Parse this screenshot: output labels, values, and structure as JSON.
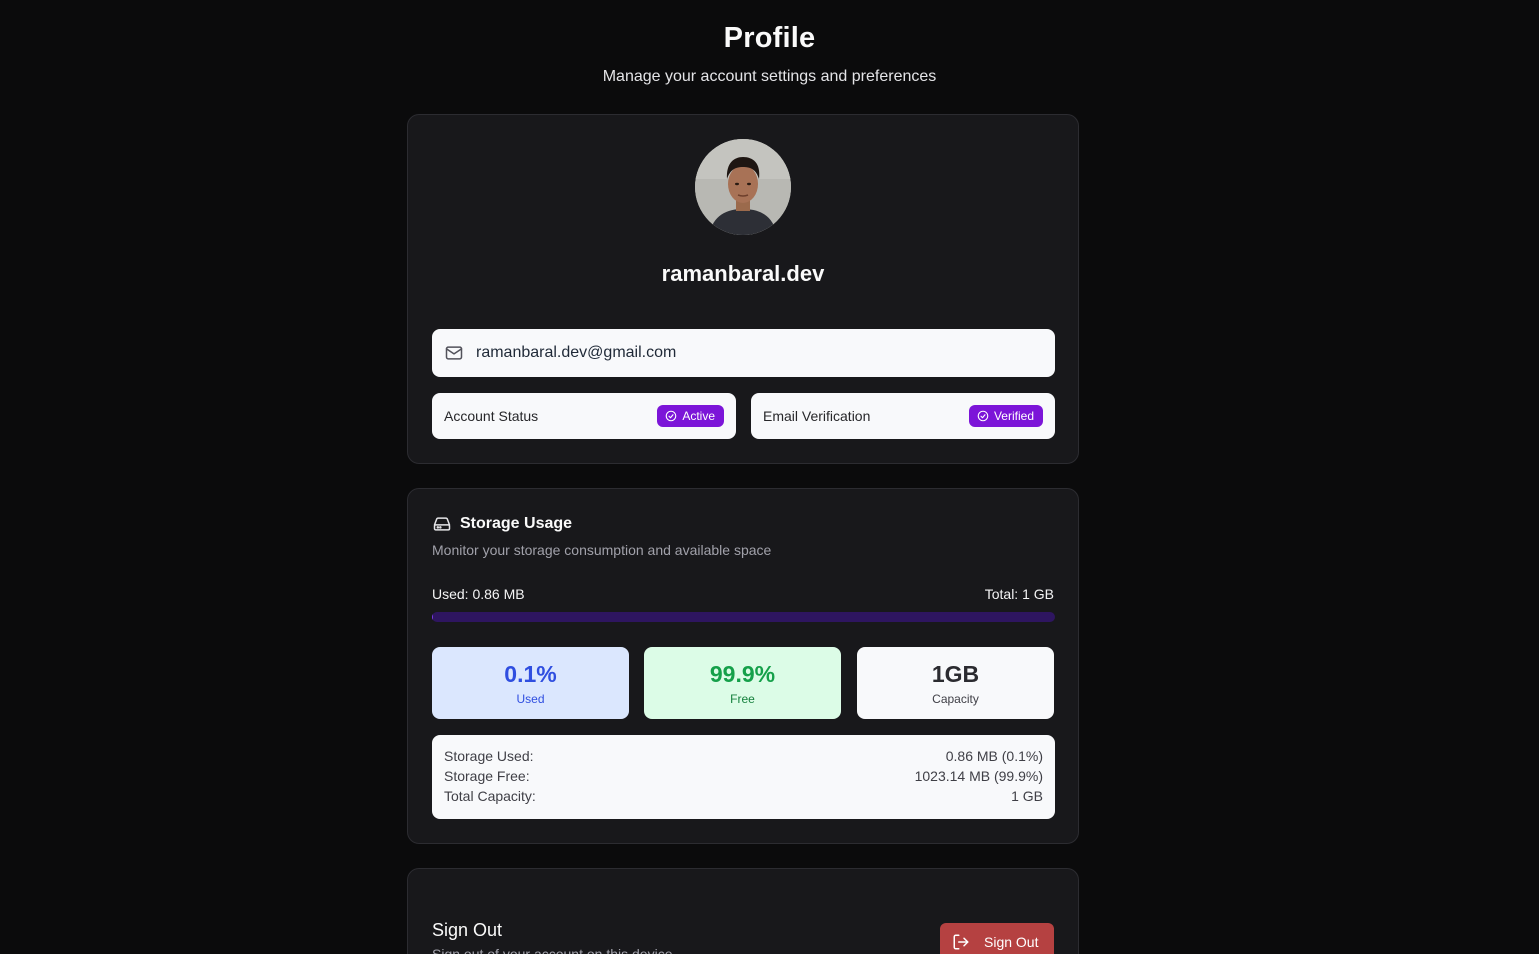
{
  "header": {
    "title": "Profile",
    "subtitle": "Manage your account settings and preferences"
  },
  "profile": {
    "username": "ramanbaral.dev",
    "email": "ramanbaral.dev@gmail.com",
    "email_icon": "mail-icon",
    "account_status_label": "Account Status",
    "account_status_badge": "Active",
    "email_verification_label": "Email Verification",
    "email_verification_badge": "Verified",
    "badge_icon": "check-circle-icon",
    "badge_color": "#7c15d8"
  },
  "storage": {
    "icon": "hard-drive-icon",
    "title": "Storage Usage",
    "description": "Monitor your storage consumption and available space",
    "used_label": "Used: 0.86 MB",
    "total_label": "Total: 1 GB",
    "progress_fraction": 0.001,
    "stats": {
      "used_value": "0.1%",
      "used_label": "Used",
      "free_value": "99.9%",
      "free_label": "Free",
      "capacity_value": "1GB",
      "capacity_label": "Capacity"
    },
    "details": [
      {
        "label": "Storage Used:",
        "value": "0.86 MB (0.1%)"
      },
      {
        "label": "Storage Free:",
        "value": "1023.14 MB (99.9%)"
      },
      {
        "label": "Total Capacity:",
        "value": "1 GB"
      }
    ]
  },
  "signout": {
    "title": "Sign Out",
    "description": "Sign out of your account on this device",
    "button_label": "Sign Out",
    "button_icon": "log-out-icon",
    "button_color": "#b54141"
  }
}
